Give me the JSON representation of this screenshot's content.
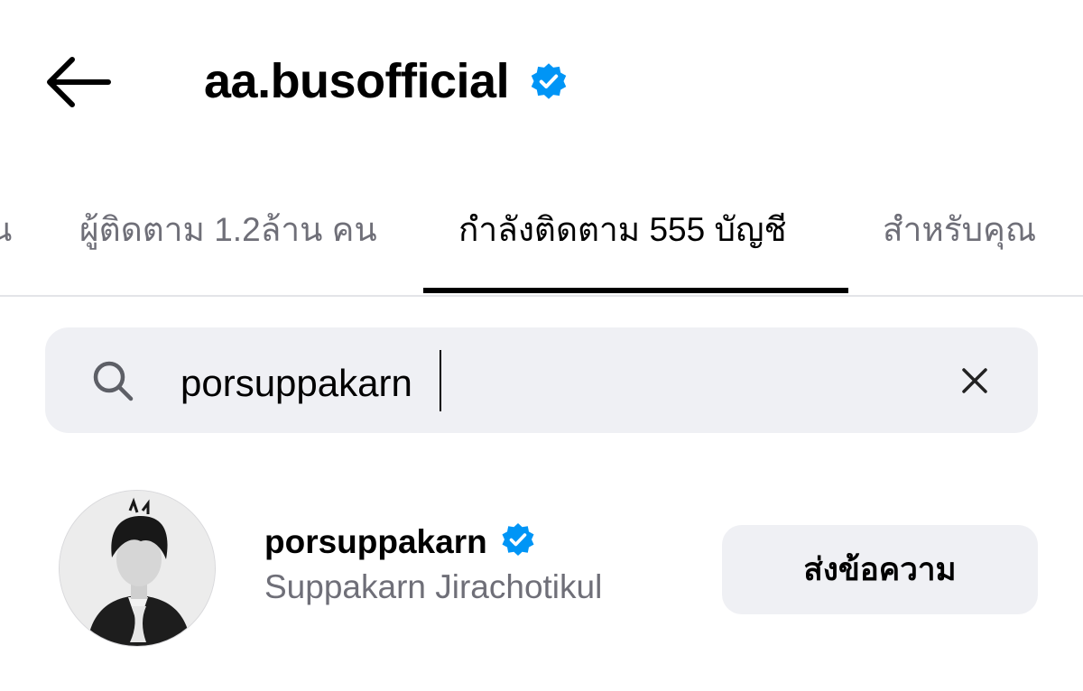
{
  "header": {
    "title": "aa.busofficial",
    "back_icon": "arrow-left-icon",
    "verified_icon": "verified-badge-icon",
    "verified_color": "#0095f6"
  },
  "tabs": {
    "cut_label": "น",
    "followers_label": "ผู้ติดตาม 1.2ล้าน คน",
    "following_label": "กำลังติดตาม 555 บัญชี",
    "for_you_label": "สำหรับคุณ",
    "active": "following"
  },
  "search": {
    "icon": "search-icon",
    "value": "porsuppakarn",
    "clear_icon": "close-icon"
  },
  "results": [
    {
      "username": "porsuppakarn",
      "full_name": "Suppakarn Jirachotikul",
      "verified": true,
      "button_label": "ส่งข้อความ"
    }
  ]
}
